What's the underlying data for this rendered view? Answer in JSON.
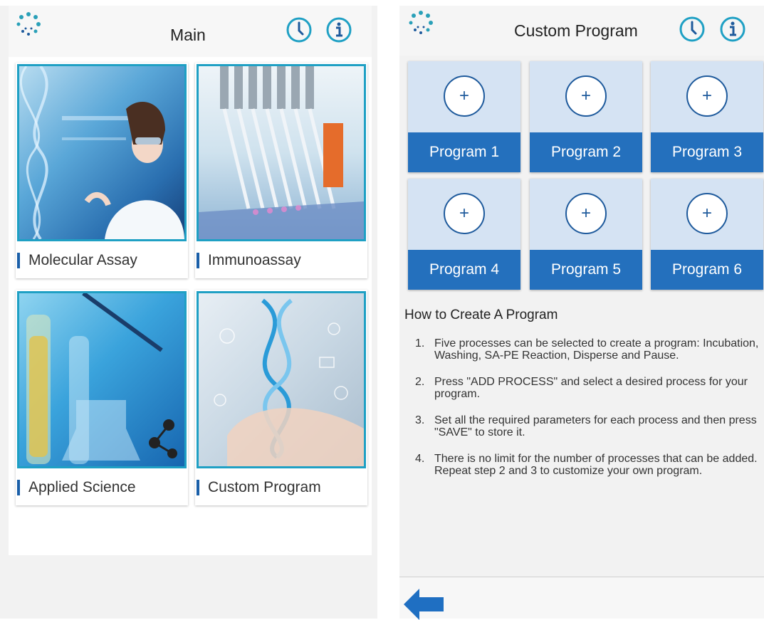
{
  "left": {
    "title": "Main",
    "tiles": [
      {
        "label": "Molecular Assay"
      },
      {
        "label": "Immunoassay"
      },
      {
        "label": "Applied Science"
      },
      {
        "label": "Custom Program"
      }
    ]
  },
  "right": {
    "title": "Custom Program",
    "programs": [
      {
        "label": "Program 1",
        "plus": "+"
      },
      {
        "label": "Program 2",
        "plus": "+"
      },
      {
        "label": "Program 3",
        "plus": "+"
      },
      {
        "label": "Program 4",
        "plus": "+"
      },
      {
        "label": "Program 5",
        "plus": "+"
      },
      {
        "label": "Program 6",
        "plus": "+"
      }
    ],
    "howto_title": "How to Create A Program",
    "steps": [
      {
        "num": "1.",
        "text": "Five processes can be selected to create a program: Incubation, Washing, SA-PE Reaction, Disperse and Pause."
      },
      {
        "num": "2.",
        "text": "Press \"ADD PROCESS\" and select a desired process for your program."
      },
      {
        "num": "3.",
        "text": "Set all the required parameters for each process and then press \"SAVE\" to store it."
      },
      {
        "num": "4.",
        "text": "There is no limit for the number of processes that can be added. Repeat step 2 and 3 to customize your own program."
      }
    ]
  },
  "icons": {
    "logo": "logo-icon",
    "history": "clock-icon",
    "info": "info-icon",
    "back": "back-arrow-icon"
  },
  "colors": {
    "accent": "#1e5a9c",
    "teal": "#1fa0c4",
    "program_blue": "#2470bd"
  }
}
